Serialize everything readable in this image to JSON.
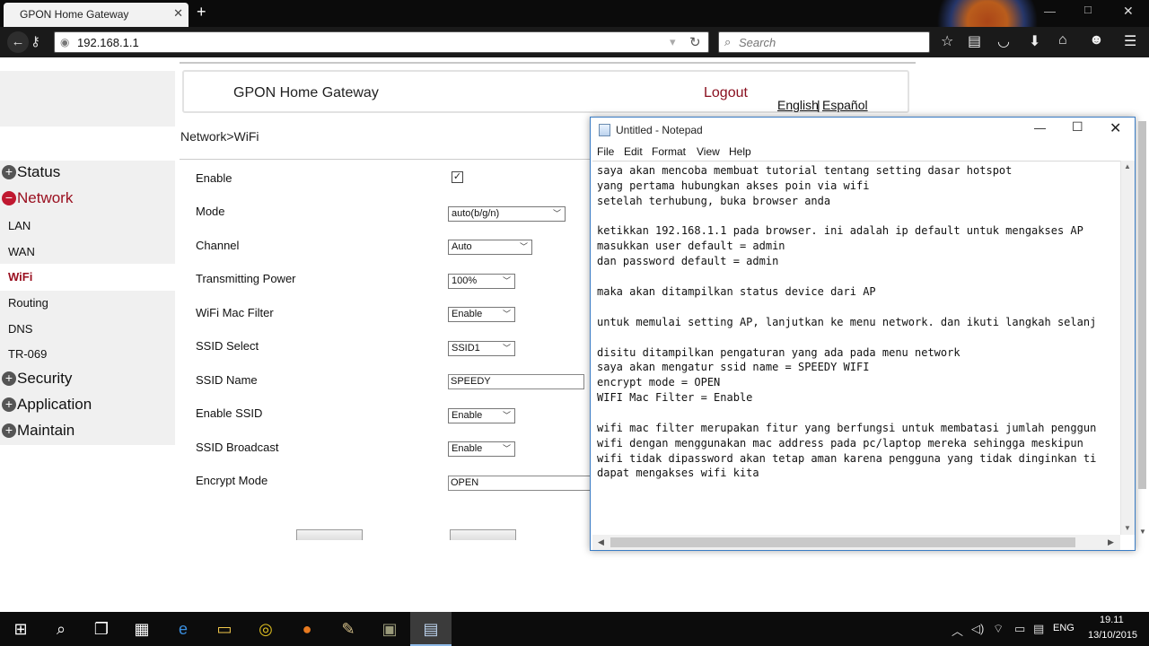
{
  "browser": {
    "tab_title": "GPON Home Gateway",
    "url": "192.168.1.1",
    "search_placeholder": "Search"
  },
  "router": {
    "brand_title": "GPON Home Gateway",
    "logout": "Logout",
    "lang_en": "English",
    "lang_sep": "|",
    "lang_es": "Español",
    "breadcrumb": "Network>WiFi",
    "menu": {
      "status": "Status",
      "network": "Network",
      "lan": "LAN",
      "wan": "WAN",
      "wifi": "WiFi",
      "routing": "Routing",
      "dns": "DNS",
      "tr069": "TR-069",
      "security": "Security",
      "application": "Application",
      "maintain": "Maintain"
    },
    "form": {
      "enable_label": "Enable",
      "enable_checked": true,
      "mode_label": "Mode",
      "mode_value": "auto(b/g/n)",
      "channel_label": "Channel",
      "channel_value": "Auto",
      "tx_power_label": "Transmitting Power",
      "tx_power_value": "100%",
      "mac_filter_label": "WiFi Mac Filter",
      "mac_filter_value": "Enable",
      "ssid_select_label": "SSID Select",
      "ssid_select_value": "SSID1",
      "ssid_name_label": "SSID Name",
      "ssid_name_value": "SPEEDY",
      "enable_ssid_label": "Enable SSID",
      "enable_ssid_value": "Enable",
      "ssid_broadcast_label": "SSID Broadcast",
      "ssid_broadcast_value": "Enable",
      "encrypt_label": "Encrypt Mode",
      "encrypt_value": "OPEN"
    }
  },
  "notepad": {
    "title": "Untitled - Notepad",
    "menu": [
      "File",
      "Edit",
      "Format",
      "View",
      "Help"
    ],
    "lines": [
      "saya akan mencoba membuat tutorial tentang setting dasar hotspot",
      "yang pertama hubungkan akses poin via wifi",
      "setelah terhubung, buka browser anda",
      "",
      "ketikkan 192.168.1.1 pada browser. ini adalah ip default untuk mengakses AP",
      "masukkan user default = admin",
      "dan password default = admin",
      "",
      "maka akan ditampilkan status device dari AP",
      "",
      "untuk memulai setting AP, lanjutkan ke menu network. dan ikuti langkah selanj",
      "",
      "disitu ditampilkan pengaturan yang ada pada menu network",
      "saya akan mengatur ssid name = SPEEDY WIFI",
      "encrypt mode = OPEN",
      "WIFI Mac Filter = Enable",
      "",
      "wifi mac filter merupakan fitur yang berfungsi untuk membatasi jumlah penggun",
      "wifi dengan menggunakan mac address pada pc/laptop mereka sehingga meskipun",
      "wifi tidak dipassword akan tetap aman karena pengguna yang tidak dinginkan ti",
      "dapat mengakses wifi kita"
    ]
  },
  "taskbar": {
    "lang": "ENG",
    "time": "19.11",
    "date": "13/10/2015"
  }
}
